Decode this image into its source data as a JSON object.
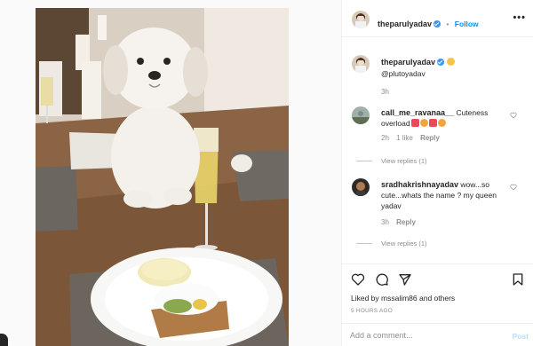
{
  "post": {
    "author": "theparulyadav",
    "follow_label": "Follow",
    "separator": "•",
    "caption_text": "@plutoyadav",
    "caption_time": "3h",
    "likes_text": "Liked by mssalim86 and others",
    "post_time": "5 HOURS AGO",
    "more_icon": "•••",
    "caption_emoji_icon": "face-emoji-icon"
  },
  "comments": [
    {
      "user": "call_me_ravanaa__",
      "text": "Cuteness overload",
      "emojis": [
        "red-heart-icon",
        "heart-eyes-icon",
        "red-heart-icon",
        "heart-eyes-icon"
      ],
      "time": "2h",
      "likes": "1 like",
      "reply_label": "Reply",
      "view_replies": "View replies (1)"
    },
    {
      "user": "sradhakrishnayadav",
      "text": "wow...so cute...whats the name ? my queen yadav",
      "time": "3h",
      "reply_label": "Reply",
      "view_replies": "View replies (1)"
    }
  ],
  "add_comment": {
    "placeholder": "Add a comment...",
    "post_label": "Post"
  },
  "colors": {
    "accent": "#0095f6",
    "verified": "#3897f0",
    "heart": "#ed4956"
  }
}
